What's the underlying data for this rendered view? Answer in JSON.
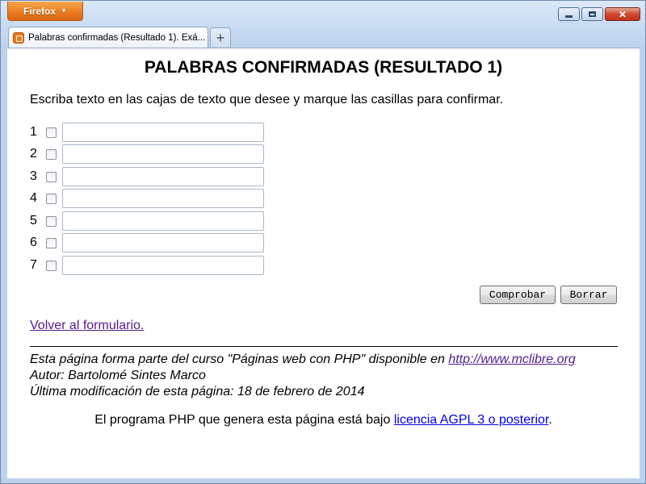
{
  "browser": {
    "menu_button_label": "Firefox",
    "menu_arrow": "▼",
    "tab_title": "Palabras confirmadas (Resultado 1). Exá...",
    "new_tab_label": "+",
    "tab_icon": "xampp-favicon",
    "controls": {
      "close_label": "✕"
    }
  },
  "page": {
    "heading": "PALABRAS CONFIRMADAS (RESULTADO 1)",
    "intro": "Escriba texto en las cajas de texto que desee y marque las casillas para confirmar.",
    "rows": [
      {
        "number": "1",
        "value": ""
      },
      {
        "number": "2",
        "value": ""
      },
      {
        "number": "3",
        "value": ""
      },
      {
        "number": "4",
        "value": ""
      },
      {
        "number": "5",
        "value": ""
      },
      {
        "number": "6",
        "value": ""
      },
      {
        "number": "7",
        "value": ""
      }
    ],
    "buttons": {
      "check": "Comprobar",
      "clear": "Borrar"
    },
    "back_link": "Volver al formulario.",
    "footer": {
      "line1_text": "Esta página forma parte del curso \"Páginas web con PHP\" disponible en ",
      "line1_link": "http://www.mclibre.org",
      "line2": "Autor: Bartolomé Sintes Marco",
      "line3": "Última modificación de esta página: 18 de febrero de 2014"
    },
    "license": {
      "text": "El programa PHP que genera esta página está bajo ",
      "link": "licencia AGPL 3 o posterior",
      "end": "."
    }
  },
  "colors": {
    "firefox_button": "#e8791e",
    "visited_link": "#551a8b",
    "unvisited_link": "#0000ee",
    "close_button": "#c0301b"
  }
}
